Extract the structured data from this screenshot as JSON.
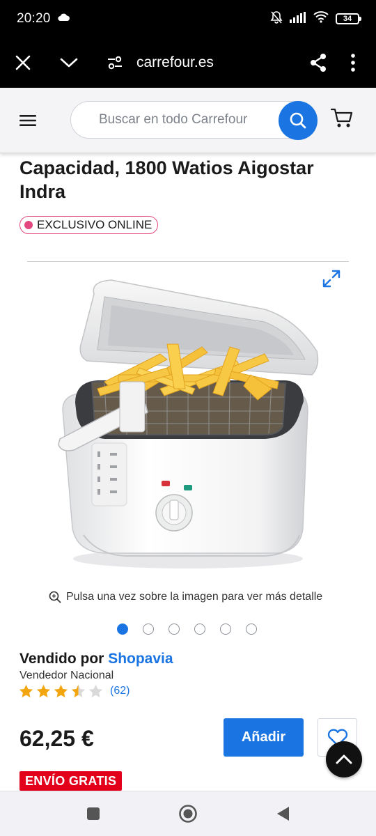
{
  "status_bar": {
    "time": "20:20",
    "battery": "34"
  },
  "browser": {
    "url": "carrefour.es"
  },
  "search": {
    "placeholder": "Buscar en todo Carrefour"
  },
  "product": {
    "title": "Capacidad, 1800 Watios Aigostar Indra",
    "badge": "EXCLUSIVO ONLINE",
    "zoom_hint": "Pulsa una vez sobre la imagen para ver más detalle",
    "image_count": 6,
    "active_image": 1,
    "seller_prefix": "Vendido por",
    "seller_name": "Shopavia",
    "seller_type": "Vendedor Nacional",
    "rating": 3.5,
    "rating_max": 5,
    "rating_count": "(62)",
    "price": "62,25 €",
    "add_label": "Añadir",
    "shipping": "ENVÍO GRATIS"
  },
  "colors": {
    "accent": "#1a74e2",
    "badge_pink": "#e2487f",
    "shipping_red": "#e3001b",
    "star": "#f2a50d"
  },
  "icons": {
    "close": "close-icon",
    "down": "chevron-down-icon",
    "site_settings": "tune-icon",
    "share": "share-icon",
    "more": "more-vert-icon",
    "menu": "menu-icon",
    "search": "search-icon",
    "cart": "cart-icon",
    "expand": "expand-icon",
    "zoom": "zoom-in-icon",
    "wishlist": "heart-icon",
    "scroll_top": "chevron-up-icon"
  }
}
